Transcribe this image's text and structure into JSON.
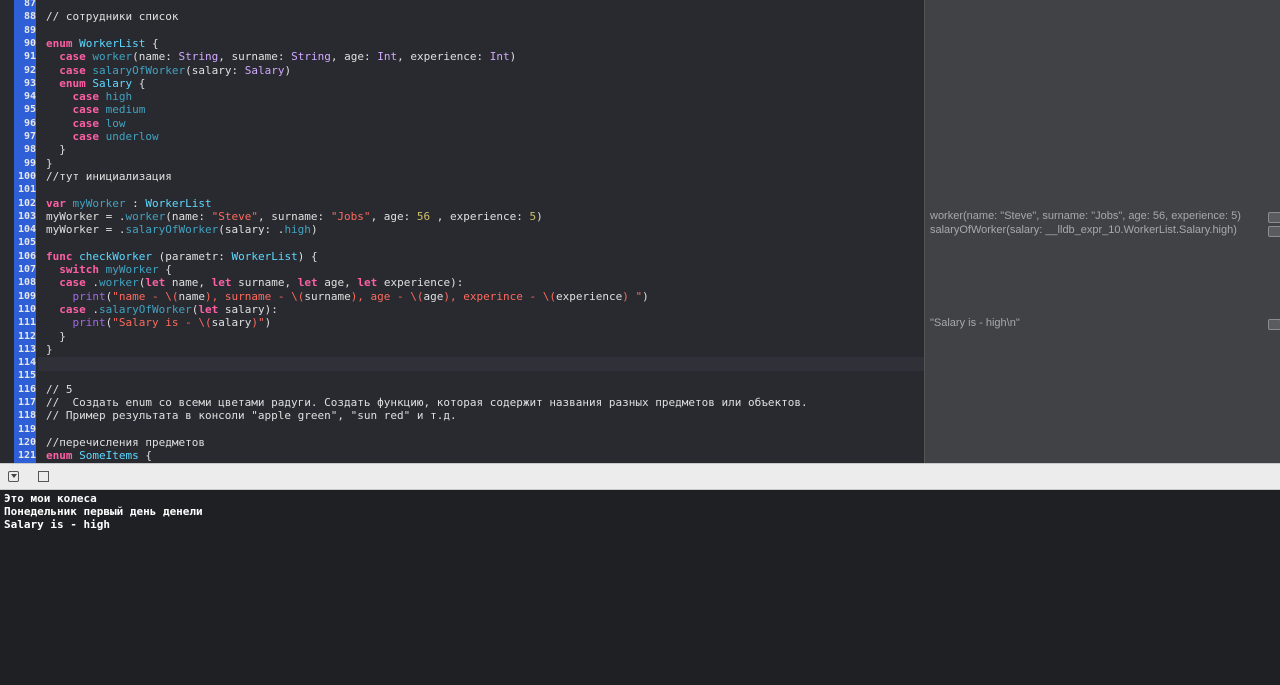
{
  "editor": {
    "line_numbers": [
      "87",
      "88",
      "89",
      "90",
      "91",
      "92",
      "93",
      "94",
      "95",
      "96",
      "97",
      "98",
      "99",
      "100",
      "101",
      "102",
      "103",
      "104",
      "105",
      "106",
      "107",
      "108",
      "109",
      "110",
      "111",
      "112",
      "113",
      "114",
      "115",
      "116",
      "117",
      "118",
      "119",
      "120",
      "121"
    ],
    "tokens": {
      "l88": "// сотрудники список",
      "l90_kw": "enum",
      "l90_name": "WorkerList",
      "l90_rest": " {",
      "l91_kw": "case",
      "l91_fn": "worker",
      "l91_a": "(name: ",
      "l91_t1": "String",
      "l91_b": ", surname: ",
      "l91_t2": "String",
      "l91_c": ", age: ",
      "l91_t3": "Int",
      "l91_d": ", experience: ",
      "l91_t4": "Int",
      "l91_e": ")",
      "l92_kw": "case",
      "l92_fn": "salaryOfWorker",
      "l92_a": "(salary: ",
      "l92_t": "Salary",
      "l92_b": ")",
      "l93_kw": "enum",
      "l93_name": "Salary",
      "l93_rest": " {",
      "l94_kw": "case",
      "l94_v": "high",
      "l95_kw": "case",
      "l95_v": "medium",
      "l96_kw": "case",
      "l96_v": "low",
      "l97_kw": "case",
      "l97_v": "underlow",
      "l98": "}",
      "l99": "}",
      "l100": "//тут инициализация",
      "l102_kw": "var",
      "l102_name": "myWorker",
      "l102_a": " : ",
      "l102_t": "WorkerList",
      "l103_a": "myWorker = .",
      "l103_fn": "worker",
      "l103_b": "(name: ",
      "l103_s1": "\"Steve\"",
      "l103_c": ", surname: ",
      "l103_s2": "\"Jobs\"",
      "l103_d": ", age: ",
      "l103_n1": "56",
      "l103_e": " , experience: ",
      "l103_n2": "5",
      "l103_f": ")",
      "l104_a": "myWorker = .",
      "l104_fn": "salaryOfWorker",
      "l104_b": "(salary: .",
      "l104_v": "high",
      "l104_c": ")",
      "l106_kw": "func",
      "l106_name": "checkWorker",
      "l106_a": " (parametr: ",
      "l106_t": "WorkerList",
      "l106_b": ") {",
      "l107_kw": "switch",
      "l107_v": "myWorker",
      "l107_a": " {",
      "l108_kw": "case",
      "l108_a": " .",
      "l108_fn": "worker",
      "l108_b": "(",
      "l108_k1": "let",
      "l108_c": " name, ",
      "l108_k2": "let",
      "l108_d": " surname, ",
      "l108_k3": "let",
      "l108_e": " age, ",
      "l108_k4": "let",
      "l108_f": " experience):",
      "l109_fn": "print",
      "l109_a": "(",
      "l109_s1": "\"name - \\(",
      "l109_p1": "name",
      "l109_s2": "), surname - \\(",
      "l109_p2": "surname",
      "l109_s3": "), age - \\(",
      "l109_p3": "age",
      "l109_s4": "), experince - \\(",
      "l109_p4": "experience",
      "l109_s5": ") \"",
      "l109_b": ")",
      "l110_kw": "case",
      "l110_a": " .",
      "l110_fn": "salaryOfWorker",
      "l110_b": "(",
      "l110_k": "let",
      "l110_c": " salary):",
      "l111_fn": "print",
      "l111_a": "(",
      "l111_s1": "\"Salary is - \\(",
      "l111_p": "salary",
      "l111_s2": ")\"",
      "l111_b": ")",
      "l112": "}",
      "l113": "}",
      "l116": "// 5",
      "l117": "//  Создать enum со всеми цветами радуги. Создать функцию, которая содержит названия разных предметов или объектов.",
      "l118": "// Пример результата в консоли \"apple green\", \"sun red\" и т.д.",
      "l120": "//перечисления предметов",
      "l121_kw": "enum",
      "l121_name": "SomeItems",
      "l121_rest": " {"
    }
  },
  "results": {
    "r103": "worker(name: \"Steve\", surname: \"Jobs\", age: 56, experience: 5)",
    "r104": "salaryOfWorker(salary: __lldb_expr_10.WorkerList.Salary.high)",
    "r111": "\"Salary is - high\\n\""
  },
  "console": {
    "lines": [
      "Это мои колеса",
      "Понедельник первый день денели",
      "Salary is - high"
    ]
  }
}
